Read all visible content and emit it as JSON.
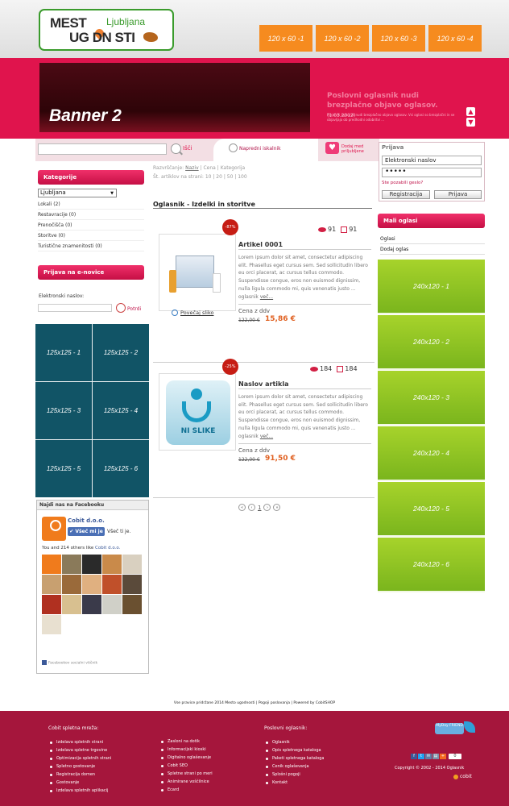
{
  "logo": {
    "line1": "MEST",
    "line2": "UG DN STI",
    "city": "Ljubljana"
  },
  "top_ads": [
    "120 x 60 -1",
    "120 x 60 -2",
    "120 x 60 -3",
    "120 x 60 -4"
  ],
  "banner": {
    "label": "Banner 2",
    "headline": "Poslovni oglasnik nudi brezplačno objavo oglasov.",
    "headline_small": "(1.03.2012)",
    "text": "Poslovni oglasnik nudi brezplačno objavo oglasov. Vsi oglasi so brezplačni in se objavljajo ob predhodni odobritvi ..."
  },
  "search": {
    "button_label": "Išči",
    "advanced_label": "Napredni iskalnik",
    "favorites_label": "Dodaj med priljubljene"
  },
  "login": {
    "title": "Prijava",
    "email_value": "Elektronski naslov",
    "password_value": "•••••",
    "forgot": "Ste pozabili geslo?",
    "register": "Registracija",
    "login": "Prijava"
  },
  "categories": {
    "title": "Kategorije",
    "city": "Ljubljana",
    "items": [
      "Lokali (2)",
      "Restavracije (0)",
      "Prenočišča (0)",
      "Storitve (0)",
      "Turistične znamenitosti (0)"
    ]
  },
  "newsletter": {
    "title": "Prijava na e-novice",
    "label": "Elektronski naslov:",
    "button": "Potrdi"
  },
  "ads125": [
    "125x125 - 1",
    "125x125 - 2",
    "125x125 - 3",
    "125x125 - 4",
    "125x125 - 5",
    "125x125 - 6"
  ],
  "facebook": {
    "title": "Najdi nas na Facebooku",
    "page_name": "Cobit d.o.o.",
    "like_button": "✔ Všeč mi je",
    "like_text": "Všeč ti je.",
    "others_prefix": "You and 214 others like",
    "others_link": "Cobit d.o.o.",
    "plugin": "Facebookov socialni vtičnik"
  },
  "sort": {
    "label": "Razvrščanje:",
    "name": "Naziv",
    "rest": "| Cena | Kategorija",
    "perpage": "Št. artiklov na strani: 10 | 20 | 50 | 100"
  },
  "content_title": "Oglasnik - Izdelki in storitve",
  "products": [
    {
      "name": "Artikel 0001",
      "badge": "-87%",
      "views": "91",
      "days": "91",
      "desc": "Lorem ipsum dolor sit amet, consectetur adipiscing elit. Phasellus eget cursus sem. Sed sollicitudin libero eu orci placerat, ac cursus tellus commodo. Suspendisse congue, eros non euismod dignissim, nulla ligula commodo mi, quis venenatis justo ... oglasnik",
      "more": "več...",
      "price_label": "Cena z ddv",
      "old_price": "122,00 €",
      "new_price": "15,86 €"
    },
    {
      "name": "Naslov artikla",
      "badge": "-25%",
      "views": "184",
      "days": "184",
      "desc": "Lorem ipsum dolor sit amet, consectetur adipiscing elit. Phasellus eget cursus sem. Sed sollicitudin libero eu orci placerat, ac cursus tellus commodo. Suspendisse congue, eros non euismod dignissim, nulla ligula commodo mi, quis venenatis justo ... oglasnik",
      "more": "več...",
      "price_label": "Cena z ddv",
      "old_price": "122,00 €",
      "new_price": "91,50 €"
    }
  ],
  "zoom_label": "Povečaj sliko",
  "noimage_label": "NI SLIKE",
  "pager": {
    "first": "«",
    "prev": "‹",
    "current": "1",
    "next": "›",
    "last": "»"
  },
  "mini": {
    "title": "Mali oglasi",
    "items": [
      "Oglasi",
      "Dodaj oglas"
    ]
  },
  "ads240": [
    "240x120 - 1",
    "240x120 - 2",
    "240x120 - 3",
    "240x120 - 4",
    "240x120 - 5",
    "240x120 - 6"
  ],
  "copyright_line": "Vse pravice pridržane 2014 Mesto ugodnosti | Pogoji poslovanja | Powered by CobitSHOP",
  "footer": {
    "col1_title": "Cobit spletna mreža:",
    "col1": [
      "Izdelava spletnih strani",
      "Izdelava spletne trgovine",
      "Optimizacija spletnih strani",
      "Spletno gostovanje",
      "Registracija domen",
      "Gostovanje",
      "Izdelava spletnih aplikacij"
    ],
    "col2": [
      "Zasloni na dotik",
      "Informacijski kioski",
      "Digitalno oglaševanje",
      "Cobit SEO",
      "Spletne strani po meri",
      "Animirane voščilnice",
      "Ecard"
    ],
    "col3_title": "Poslovni oglasnik:",
    "col3": [
      "Oglasnik",
      "Opis spletnega kataloga",
      "Paketi spletnega kataloga",
      "Cenik oglaševanja",
      "Splošni pogoji",
      "Kontakt"
    ],
    "mdf": "MyDay FRIEND",
    "share_count": "0",
    "copyright": "Copyright © 2002 - 2014 Oglasnik",
    "brand": "cobit"
  },
  "colors": {
    "accent": "#e0144d",
    "orange": "#f68b1f",
    "teal": "#115466",
    "green": "#8dc423",
    "footer": "#a5163c"
  }
}
